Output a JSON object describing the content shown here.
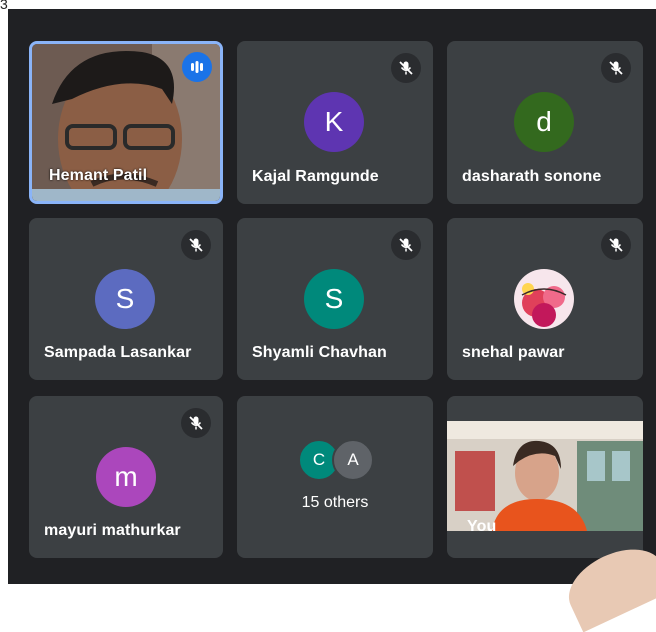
{
  "corner_text": "3",
  "participants": [
    {
      "name": "Hemant Patil",
      "type": "video",
      "speaking": true
    },
    {
      "name": "Kajal Ramgunde",
      "initial": "K",
      "avatar_color": "#5e35b1",
      "muted": true
    },
    {
      "name": "dasharath sonone",
      "initial": "d",
      "avatar_color": "#33691e",
      "muted": true
    },
    {
      "name": "Sampada Lasankar",
      "initial": "S",
      "avatar_color": "#5c6bc0",
      "muted": true
    },
    {
      "name": "Shyamli Chavhan",
      "initial": "S",
      "avatar_color": "#00897b",
      "muted": true
    },
    {
      "name": "snehal pawar",
      "type": "photo-avatar",
      "muted": true
    },
    {
      "name": "mayuri mathurkar",
      "initial": "m",
      "avatar_color": "#ab47bc",
      "muted": true
    }
  ],
  "others_tile": {
    "avatars": [
      {
        "initial": "C",
        "color": "#00897b"
      },
      {
        "initial": "A",
        "color": "#5f6368"
      }
    ],
    "label": "15 others"
  },
  "self_tile": {
    "label": "You"
  },
  "icons": {
    "mute": "mic-off-icon",
    "speaking": "audio-level-icon"
  }
}
